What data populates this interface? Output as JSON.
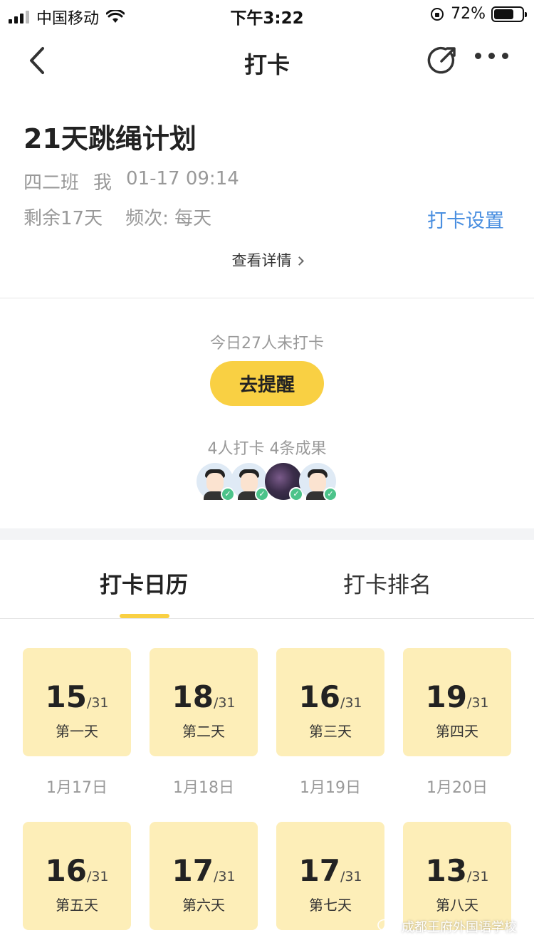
{
  "status_bar": {
    "carrier": "中国移动",
    "time": "下午3:22",
    "battery": "72%"
  },
  "nav": {
    "title": "打卡"
  },
  "plan": {
    "title": "21天跳绳计划",
    "class_name": "四二班",
    "creator": "我",
    "created_at": "01-17 09:14",
    "remaining": "剩余17天",
    "frequency": "频次: 每天",
    "settings_label": "打卡设置",
    "view_detail": "查看详情"
  },
  "reminder": {
    "unchecked_text": "今日27人未打卡",
    "remind_button": "去提醒",
    "summary": "4人打卡 4条成果"
  },
  "tabs": [
    {
      "label": "打卡日历",
      "active": true
    },
    {
      "label": "打卡排名",
      "active": false
    }
  ],
  "calendar": [
    {
      "count": "15",
      "total": "/31",
      "day": "第一天",
      "date": "1月17日"
    },
    {
      "count": "18",
      "total": "/31",
      "day": "第二天",
      "date": "1月18日"
    },
    {
      "count": "16",
      "total": "/31",
      "day": "第三天",
      "date": "1月19日"
    },
    {
      "count": "19",
      "total": "/31",
      "day": "第四天",
      "date": "1月20日"
    },
    {
      "count": "16",
      "total": "/31",
      "day": "第五天",
      "date": ""
    },
    {
      "count": "17",
      "total": "/31",
      "day": "第六天",
      "date": ""
    },
    {
      "count": "17",
      "total": "/31",
      "day": "第七天",
      "date": ""
    },
    {
      "count": "13",
      "total": "/31",
      "day": "第八天",
      "date": ""
    }
  ],
  "watermark": {
    "text": "成都王府外国语学校"
  },
  "colors": {
    "accent_yellow": "#f9d043",
    "card_yellow": "#fdeeb8",
    "link_blue": "#4a8fe0",
    "check_green": "#4cc38a"
  }
}
